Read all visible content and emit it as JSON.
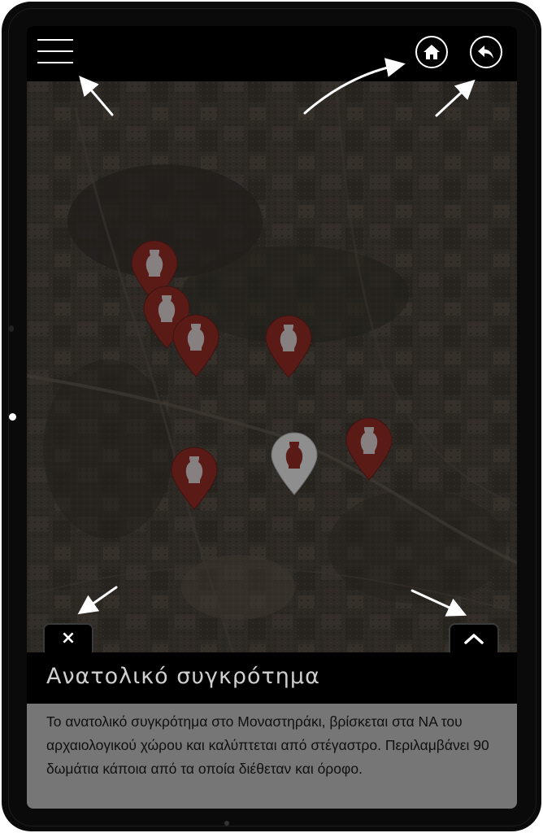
{
  "header": {
    "menu_icon": "hamburger-menu-icon",
    "home_icon": "home-icon",
    "back_icon": "back-arrow-icon"
  },
  "map": {
    "pin_icon": "amphora-pin-icon",
    "pin_color": "#5a1a16",
    "selected_pin_color": "#8e8e8e"
  },
  "panel": {
    "close_label": "×",
    "expand_icon": "chevron-up-icon",
    "title": "Ανατολικό συγκρότημα",
    "description": "Το ανατολικό συγκρότημα στο Μοναστηράκι, βρίσκεται στα ΝΑ του αρχαιολογικού χώρου και καλύπτεται από στέγαστρο. Περιλαμβάνει 90 δωμάτια κάποια από τα οποία διέθεταν και όροφο."
  },
  "colors": {
    "title_bar": "#000000",
    "description_bg": "#767676",
    "hint_arrows": "#ffffff"
  }
}
